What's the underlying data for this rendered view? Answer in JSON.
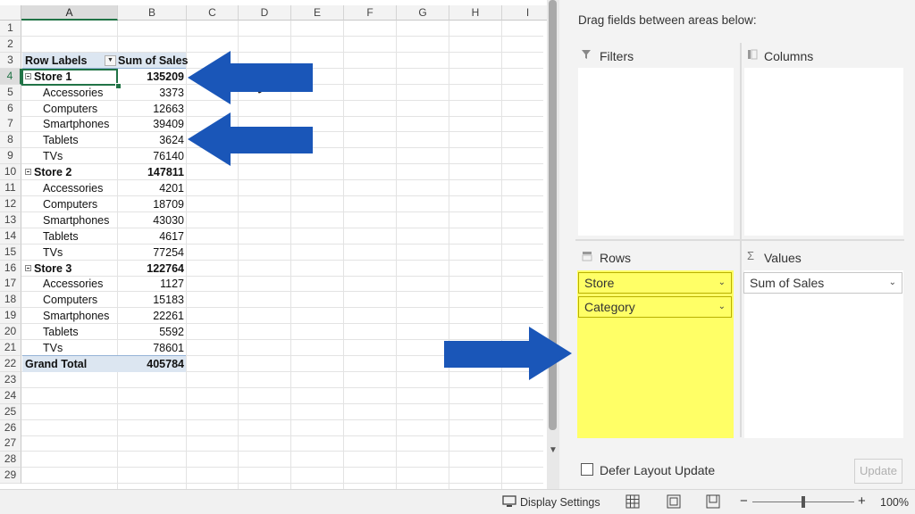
{
  "sheet": {
    "columns": [
      "A",
      "B",
      "C",
      "D",
      "E",
      "F",
      "G",
      "H",
      "I"
    ],
    "active_column": "A",
    "rows": [
      "1",
      "2",
      "3",
      "4",
      "5",
      "6",
      "7",
      "8",
      "9",
      "10",
      "11",
      "12",
      "13",
      "14",
      "15",
      "16",
      "17",
      "18",
      "19",
      "20",
      "21",
      "22",
      "23",
      "24",
      "25",
      "26",
      "27",
      "28",
      "29"
    ],
    "active_row": "4",
    "pivot": {
      "header_labels": "Row Labels",
      "header_values": "Sum of Sales",
      "lines": [
        {
          "row": 4,
          "label": "Store 1",
          "value": "135209",
          "kind": "group"
        },
        {
          "row": 5,
          "label": "Accessories",
          "value": "3373",
          "kind": "item"
        },
        {
          "row": 6,
          "label": "Computers",
          "value": "12663",
          "kind": "item"
        },
        {
          "row": 7,
          "label": "Smartphones",
          "value": "39409",
          "kind": "item"
        },
        {
          "row": 8,
          "label": "Tablets",
          "value": "3624",
          "kind": "item"
        },
        {
          "row": 9,
          "label": "TVs",
          "value": "76140",
          "kind": "item"
        },
        {
          "row": 10,
          "label": "Store 2",
          "value": "147811",
          "kind": "group"
        },
        {
          "row": 11,
          "label": "Accessories",
          "value": "4201",
          "kind": "item"
        },
        {
          "row": 12,
          "label": "Computers",
          "value": "18709",
          "kind": "item"
        },
        {
          "row": 13,
          "label": "Smartphones",
          "value": "43030",
          "kind": "item"
        },
        {
          "row": 14,
          "label": "Tablets",
          "value": "4617",
          "kind": "item"
        },
        {
          "row": 15,
          "label": "TVs",
          "value": "77254",
          "kind": "item"
        },
        {
          "row": 16,
          "label": "Store 3",
          "value": "122764",
          "kind": "group"
        },
        {
          "row": 17,
          "label": "Accessories",
          "value": "1127",
          "kind": "item"
        },
        {
          "row": 18,
          "label": "Computers",
          "value": "15183",
          "kind": "item"
        },
        {
          "row": 19,
          "label": "Smartphones",
          "value": "22261",
          "kind": "item"
        },
        {
          "row": 20,
          "label": "Tablets",
          "value": "5592",
          "kind": "item"
        },
        {
          "row": 21,
          "label": "TVs",
          "value": "78601",
          "kind": "item"
        },
        {
          "row": 22,
          "label": "Grand Total",
          "value": "405784",
          "kind": "total"
        }
      ]
    }
  },
  "pivot_pane": {
    "instruction": "Drag fields between areas below:",
    "areas": {
      "filters": {
        "label": "Filters",
        "icon": "filter-icon"
      },
      "columns": {
        "label": "Columns",
        "icon": "columns-icon"
      },
      "rows": {
        "label": "Rows",
        "icon": "rows-icon",
        "fields": [
          "Store",
          "Category"
        ]
      },
      "values": {
        "label": "Values",
        "icon": "sigma-icon",
        "fields": [
          "Sum of Sales"
        ]
      }
    },
    "defer_label": "Defer Layout Update",
    "defer_checked": false,
    "update_label": "Update",
    "highlight_color": "#ffff66"
  },
  "status_bar": {
    "display_settings": "Display Settings",
    "zoom_minus": "−",
    "zoom_plus": "+",
    "zoom_level": "100%"
  },
  "annotations": {
    "arrow_color": "#1a56b8",
    "arrows": [
      "pointing-left-at-store-1-total",
      "pointing-left-at-tablets",
      "pointing-right-at-rows-area"
    ]
  }
}
